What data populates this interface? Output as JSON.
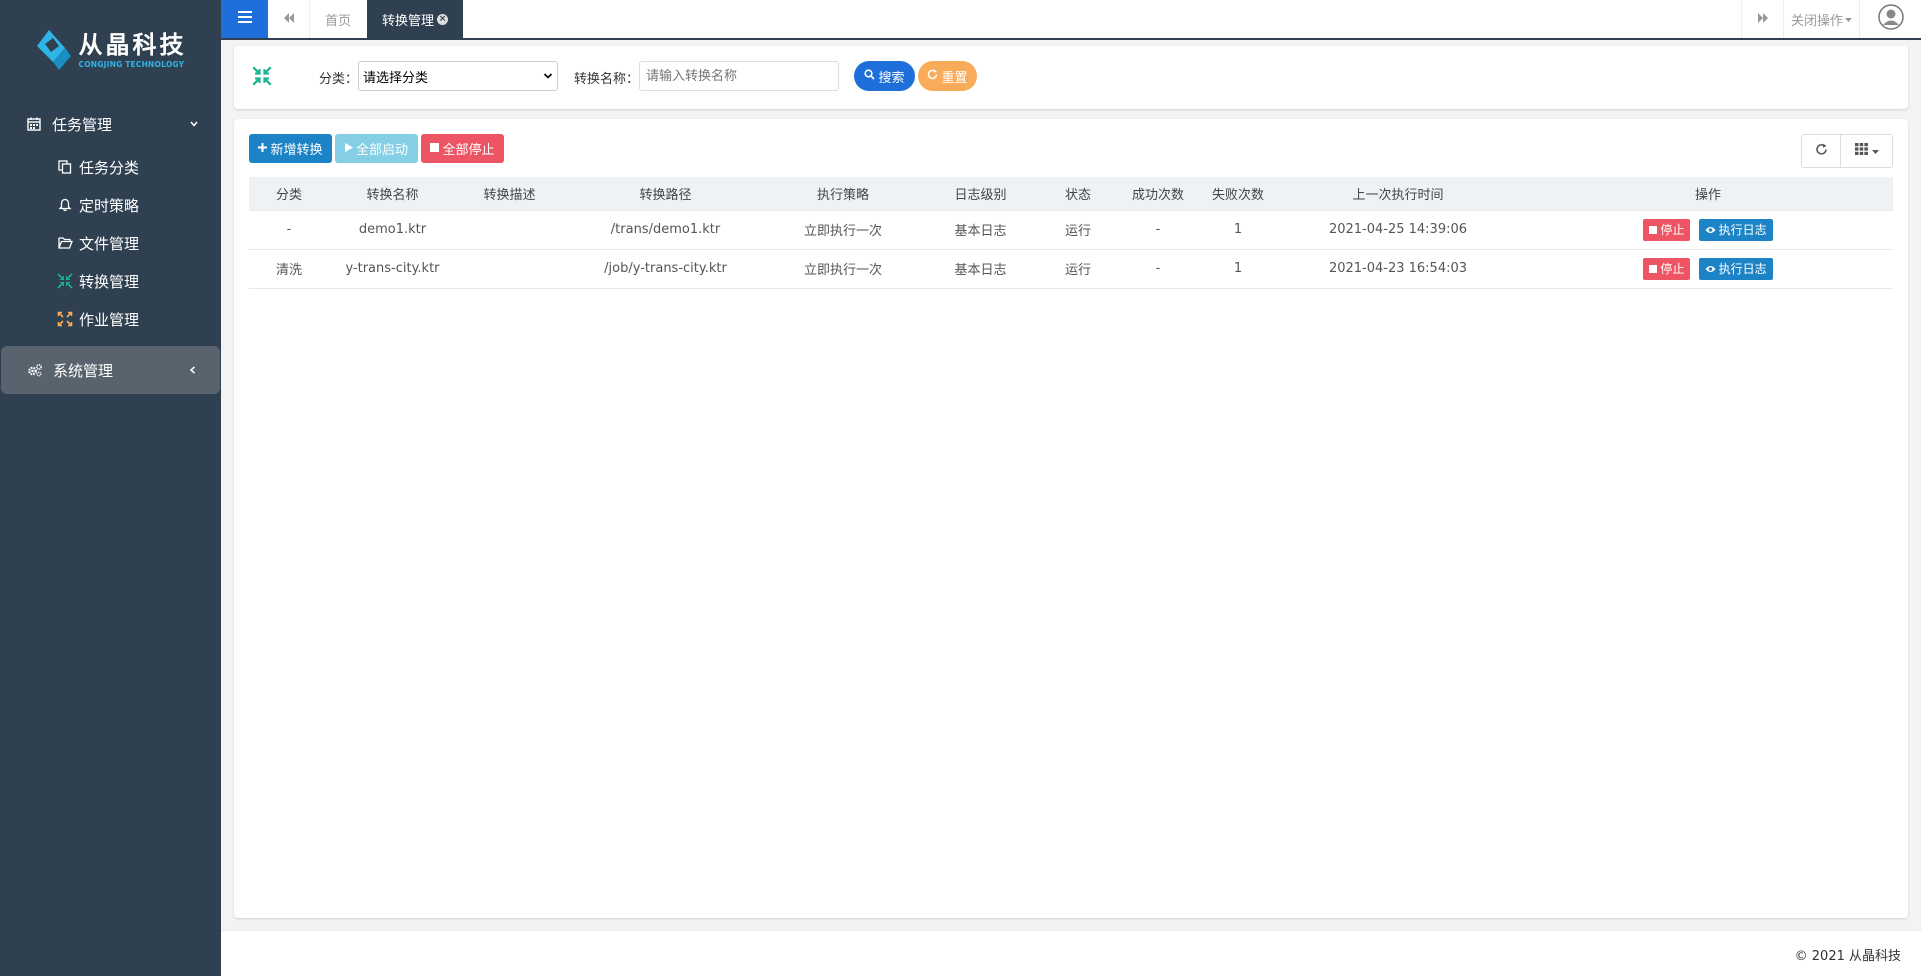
{
  "app": {
    "logo_title": "从晶科技",
    "logo_subtitle": "CONGJING TECHNOLOGY"
  },
  "sidebar": {
    "groups": [
      {
        "label": "任务管理",
        "icon": "calendar-icon",
        "expanded": true,
        "items": [
          {
            "label": "任务分类",
            "icon": "copy-icon"
          },
          {
            "label": "定时策略",
            "icon": "bell-icon"
          },
          {
            "label": "文件管理",
            "icon": "folder-open-icon"
          },
          {
            "label": "转换管理",
            "icon": "compress-icon"
          },
          {
            "label": "作业管理",
            "icon": "expand-icon"
          }
        ]
      },
      {
        "label": "系统管理",
        "icon": "gears-icon",
        "expanded": false
      }
    ]
  },
  "topbar": {
    "tabs": [
      {
        "label": "首页",
        "active": false
      },
      {
        "label": "转换管理",
        "active": true
      }
    ],
    "close_ops_label": "关闭操作"
  },
  "search": {
    "category_label": "分类：",
    "category_value": "请选择分类",
    "name_label": "转换名称：",
    "name_placeholder": "请输入转换名称",
    "search_btn": "搜索",
    "reset_btn": "重置"
  },
  "toolbar": {
    "add_btn": "新增转换",
    "start_all_btn": "全部启动",
    "stop_all_btn": "全部停止"
  },
  "table": {
    "columns": [
      "分类",
      "转换名称",
      "转换描述",
      "转换路径",
      "执行策略",
      "日志级别",
      "状态",
      "成功次数",
      "失败次数",
      "上一次执行时间",
      "操作"
    ],
    "rows": [
      {
        "category": "-",
        "name": "demo1.ktr",
        "desc": "",
        "path": "/trans/demo1.ktr",
        "strategy": "立即执行一次",
        "log_level": "基本日志",
        "status": "运行",
        "success": "-",
        "fail": "1",
        "last_run": "2021-04-25 14:39:06",
        "stop_btn": "停止",
        "log_btn": "执行日志"
      },
      {
        "category": "清洗",
        "name": "y-trans-city.ktr",
        "desc": "",
        "path": "/job/y-trans-city.ktr",
        "strategy": "立即执行一次",
        "log_level": "基本日志",
        "status": "运行",
        "success": "-",
        "fail": "1",
        "last_run": "2021-04-23 16:54:03",
        "stop_btn": "停止",
        "log_btn": "执行日志"
      }
    ]
  },
  "footer": {
    "copyright": "© 2021 从晶科技"
  },
  "colors": {
    "sidebar_bg": "#2f4050",
    "primary": "#1c84c6",
    "danger": "#ed5565",
    "warning": "#f8ac59",
    "info": "#5bc0de"
  }
}
